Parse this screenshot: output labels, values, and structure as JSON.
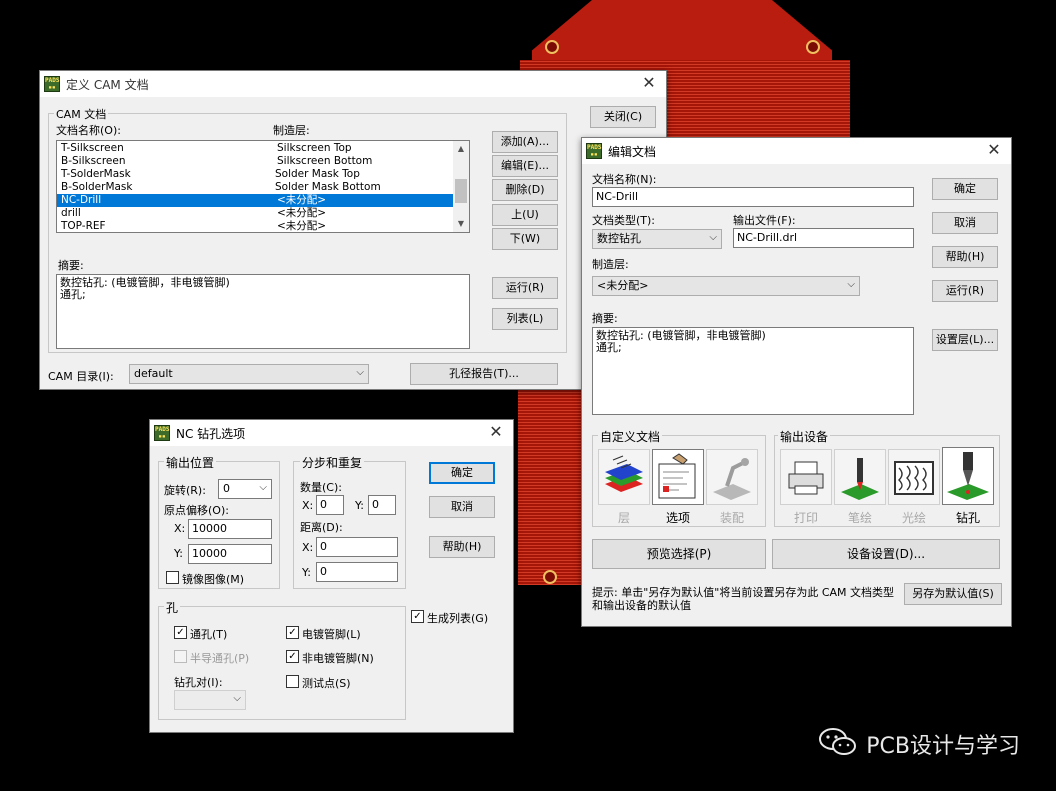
{
  "cam_window": {
    "title": "定义 CAM 文档",
    "close_glyph": "✕",
    "group_title": "CAM 文档",
    "col_name_label": "文档名称(O):",
    "col_layer_label": "制造层:",
    "rows": [
      {
        "name": "T-Silkscreen",
        "layer": "Silkscreen Top"
      },
      {
        "name": "B-Silkscreen",
        "layer": "Silkscreen Bottom"
      },
      {
        "name": "T-SolderMask",
        "layer": "Solder Mask Top"
      },
      {
        "name": "B-SolderMask",
        "layer": "Solder Mask Bottom"
      },
      {
        "name": "NC-Drill",
        "layer": "<未分配>"
      },
      {
        "name": "drill",
        "layer": "<未分配>"
      },
      {
        "name": "TOP-REF",
        "layer": "<未分配>"
      }
    ],
    "selected_row": 4,
    "summary_label": "摘要:",
    "summary_text": "数控钻孔: (电镀管脚，非电镀管脚)\n通孔;",
    "buttons": {
      "close": "关闭(C)",
      "add": "添加(A)...",
      "edit": "编辑(E)...",
      "delete": "删除(D)",
      "up": "上(U)",
      "down": "下(W)",
      "run": "运行(R)",
      "list": "列表(L)",
      "drill_report": "孔径报告(T)..."
    },
    "cam_dir_label": "CAM 目录(I):",
    "cam_dir_value": "default"
  },
  "edit_window": {
    "title": "编辑文档",
    "close_glyph": "✕",
    "doc_name_label": "文档名称(N):",
    "doc_name_value": "NC-Drill",
    "doc_type_label": "文档类型(T):",
    "doc_type_value": "数控钻孔",
    "output_file_label": "输出文件(F):",
    "output_file_value": "NC-Drill.drl",
    "layer_label": "制造层:",
    "layer_value": "<未分配>",
    "summary_label": "摘要:",
    "summary_text": "数控钻孔: (电镀管脚，非电镀管脚)\n通孔;",
    "buttons": {
      "ok": "确定",
      "cancel": "取消",
      "help": "帮助(H)",
      "run": "运行(R)",
      "set_layer": "设置层(L)...",
      "preview": "预览选择(P)",
      "device_setup": "设备设置(D)...",
      "save_default": "另存为默认值(S)"
    },
    "custom_group": "自定义文档",
    "custom_items": [
      "层",
      "选项",
      "装配"
    ],
    "output_group": "输出设备",
    "output_items": [
      "打印",
      "笔绘",
      "光绘",
      "钻孔"
    ],
    "hint": "提示: 单击\"另存为默认值\"将当前设置另存为此 CAM 文档类型和输出设备的默认值"
  },
  "nc_window": {
    "title": "NC 钻孔选项",
    "close_glyph": "✕",
    "output_pos_group": "输出位置",
    "rotate_label": "旋转(R):",
    "rotate_value": "0",
    "origin_label": "原点偏移(O):",
    "x_label": "X:",
    "y_label": "Y:",
    "origin_x": "10000",
    "origin_y": "10000",
    "mirror_label": "镜像图像(M)",
    "step_group": "分步和重复",
    "count_label": "数量(C):",
    "count_x": "0",
    "count_y": "0",
    "distance_label": "距离(D):",
    "dist_x": "0",
    "dist_y": "0",
    "hole_group": "孔",
    "through_label": "通孔(T)",
    "semi_label": "半导通孔(P)",
    "drill_pair_label": "钻孔对(I):",
    "plated_label": "电镀管脚(L)",
    "nonplated_label": "非电镀管脚(N)",
    "testpoint_label": "测试点(S)",
    "gen_list_label": "生成列表(G)",
    "check": "✓",
    "buttons": {
      "ok": "确定",
      "cancel": "取消",
      "help": "帮助(H)"
    }
  },
  "watermark": "PCB设计与学习"
}
